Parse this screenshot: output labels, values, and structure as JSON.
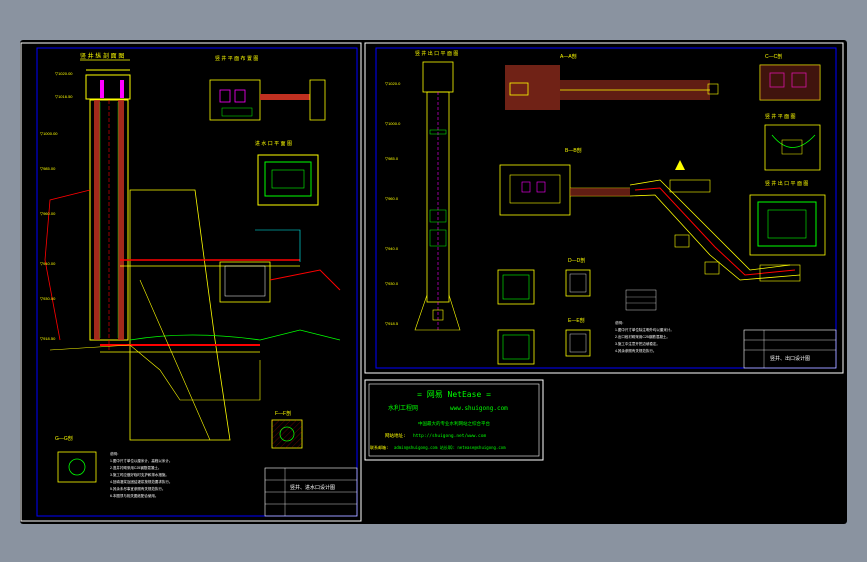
{
  "left_sheet": {
    "view_main": "竖 井 纵 剖 面 图",
    "view_plan": "竖 井 平 面 布 置 图",
    "view_detail": "进 水 口 平 面 图",
    "section_ff": "F—F剖",
    "section_gg": "G—G剖",
    "title_block": "竖井、进水口设计图"
  },
  "right_sheet": {
    "view_main": "竖 井 出 口 平 面 图",
    "section_aa": "A—A剖",
    "section_bb": "B—B剖",
    "section_cc": "C—C剖",
    "section_dd": "D—D剖",
    "section_ee": "E—E剖",
    "detail_1": "竖 井 平 面 图",
    "detail_2": "竖 井 出 口 平 面 图",
    "title_block": "竖井、出口设计图"
  },
  "stamp": {
    "line1": "= 网易 NetEase =",
    "line2_left": "水利工程网",
    "line2_right": "www.shuigong.com",
    "line3": "中国最大的专业水利网站之综合平台",
    "line4_label": "网站地址:",
    "line4_value": "http://shuigong.net/www.com",
    "line5_label": "联系邮箱:",
    "line5_value": "admin@shuigong.com  站长QQ: netease@shuigong.com"
  },
  "colors": {
    "background": "#8a93a0",
    "viewport": "#000000",
    "frame": "#ffffff",
    "border": "#0000ff",
    "cad_yellow": "#ffff00",
    "cad_green": "#00ff00",
    "cad_red": "#ff0000",
    "cad_magenta": "#ff00ff",
    "cad_cyan": "#00ffff"
  }
}
